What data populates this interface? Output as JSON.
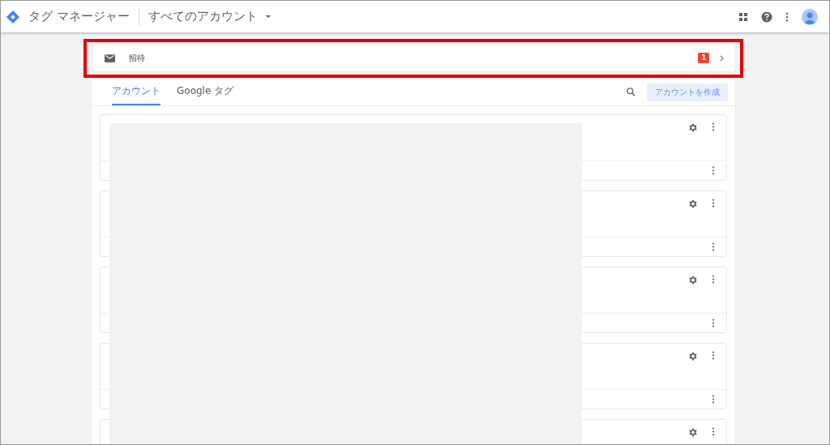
{
  "header": {
    "product": "タグ マネージャー",
    "account_selector": "すべてのアカウント"
  },
  "invitations": {
    "label": "招待",
    "count": "1",
    "highlighted": true
  },
  "tabs": [
    {
      "label": "アカウント",
      "selected": true
    },
    {
      "label": "Google タグ",
      "selected": false
    }
  ],
  "create_button": "アカウントを作成"
}
